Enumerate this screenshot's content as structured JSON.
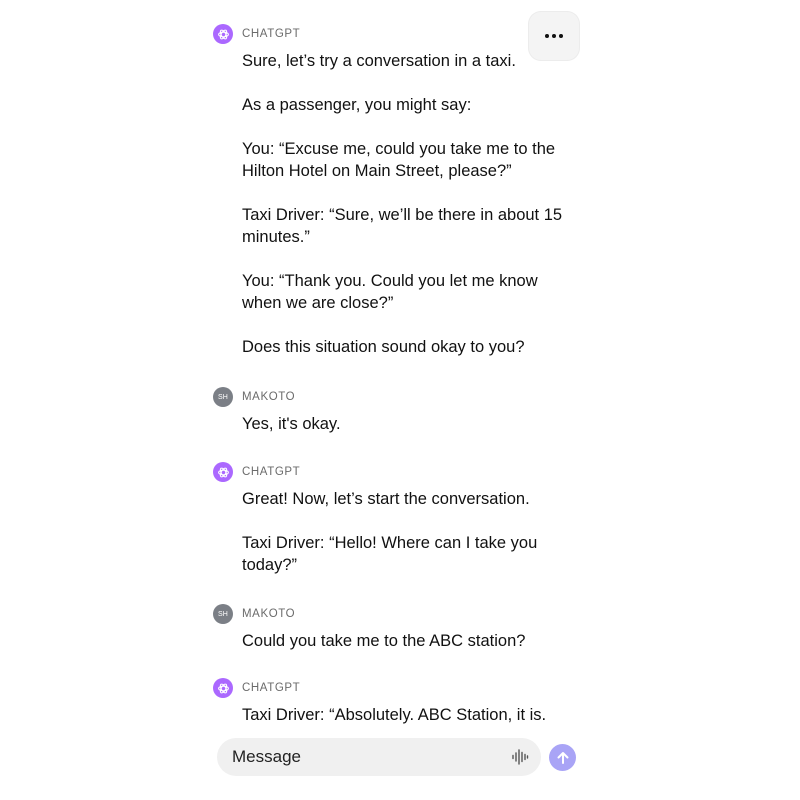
{
  "conversation": {
    "messages": [
      {
        "sender": "CHATGPT",
        "avatar_icon": "openai-logo-icon",
        "paragraphs": [
          "Sure, let’s try a conversation in a taxi.",
          "As a passenger, you might say:",
          "You: “Excuse me, could you take me to the Hilton Hotel on Main Street, please?”",
          "Taxi Driver: “Sure, we’ll be there in about 15 minutes.”",
          "You: “Thank you. Could you let me know when we are close?”",
          "Does this situation sound okay to you?"
        ]
      },
      {
        "sender": "MAKOTO",
        "avatar_initials": "SH",
        "paragraphs": [
          "Yes, it's okay."
        ]
      },
      {
        "sender": "CHATGPT",
        "avatar_icon": "openai-logo-icon",
        "paragraphs": [
          "Great! Now, let’s start the conversation.",
          "Taxi Driver: “Hello! Where can I take you today?”"
        ]
      },
      {
        "sender": "MAKOTO",
        "avatar_initials": "SH",
        "paragraphs": [
          "Could you take me to the ABC station?"
        ]
      },
      {
        "sender": "CHATGPT",
        "avatar_icon": "openai-logo-icon",
        "paragraphs": [
          "Taxi Driver: “Absolutely. ABC Station, it is."
        ]
      }
    ]
  },
  "more_menu": {
    "icon": "more-horizontal-icon"
  },
  "composer": {
    "placeholder": "Message",
    "mic_icon": "voice-waveform-icon",
    "send_icon": "arrow-up-icon"
  },
  "colors": {
    "chatgpt_avatar": "#ab68ff",
    "user_avatar": "#7b7f86",
    "send_button": "#a9a4f6",
    "input_background": "#f0f0f0"
  }
}
